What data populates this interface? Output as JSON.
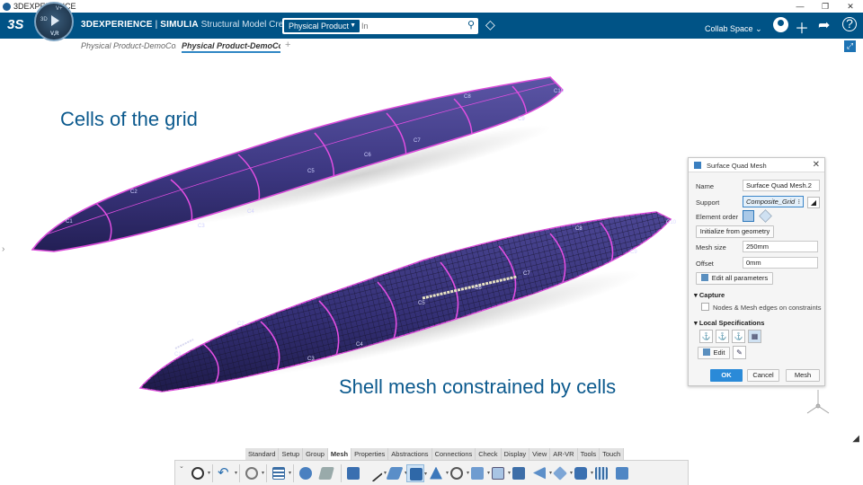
{
  "os": {
    "title": "3DEXPERIENCE",
    "controls": [
      "—",
      "❐",
      "✕"
    ]
  },
  "header": {
    "logo": "3S",
    "compass": {
      "label_3d": "3D",
      "label_v": "V,R",
      "label_r": "V+"
    },
    "brand_main": "3DEXPERIENCE",
    "brand_sep": "|",
    "brand_product": "SIMULIA",
    "brand_app": "Structural Model Creation",
    "search_scope": "Physical Product",
    "search_placeholder": "In",
    "collab_space": "Collab Space",
    "collab_caret": "⌄",
    "icons": [
      "search-icon",
      "tag-icon",
      "plus-icon",
      "share-icon",
      "help-icon"
    ]
  },
  "tabs": [
    {
      "label": "Physical Product-DemoComp"
    },
    {
      "label": "Physical Product-DemoCom"
    }
  ],
  "viewport": {
    "caption_top": "Cells of the grid",
    "caption_bottom": "Shell mesh constrained by cells",
    "top_cells": [
      "C1",
      "C2",
      "C3",
      "C4",
      "C5",
      "C6",
      "C7",
      "C8",
      "C9",
      "C10"
    ],
    "bottom_cells": [
      "C1",
      "C2",
      "C3",
      "C4",
      "C5",
      "C6",
      "C7",
      "C8",
      "C9",
      "C10"
    ]
  },
  "dialog": {
    "title": "Surface Quad Mesh",
    "name_label": "Name",
    "name_value": "Surface Quad Mesh.2",
    "support_label": "Support",
    "support_value": "Composite_Grid",
    "support_caret": "⁝",
    "element_order_label": "Element order",
    "init_button": "Initialize from geometry",
    "mesh_size_label": "Mesh size",
    "mesh_size_value": "250mm",
    "offset_label": "Offset",
    "offset_value": "0mm",
    "edit_all_button": "Edit all parameters",
    "capture_section": "Capture",
    "capture_checkbox": "Nodes & Mesh edges on constraints",
    "capture_checked": false,
    "local_spec_section": "Local Specifications",
    "edit_button": "Edit",
    "ok_button": "OK",
    "cancel_button": "Cancel",
    "mesh_button": "Mesh"
  },
  "action_tabs": [
    "Standard",
    "Setup",
    "Group",
    "Mesh",
    "Properties",
    "Abstractions",
    "Connections",
    "Check",
    "Display",
    "View",
    "AR-VR",
    "Tools",
    "Touch"
  ],
  "action_tab_active": "Mesh",
  "colors": {
    "header": "#005386",
    "accent": "#2a8ad8",
    "mesh_face": "#3b3779",
    "cell_edge": "#e040e0"
  }
}
